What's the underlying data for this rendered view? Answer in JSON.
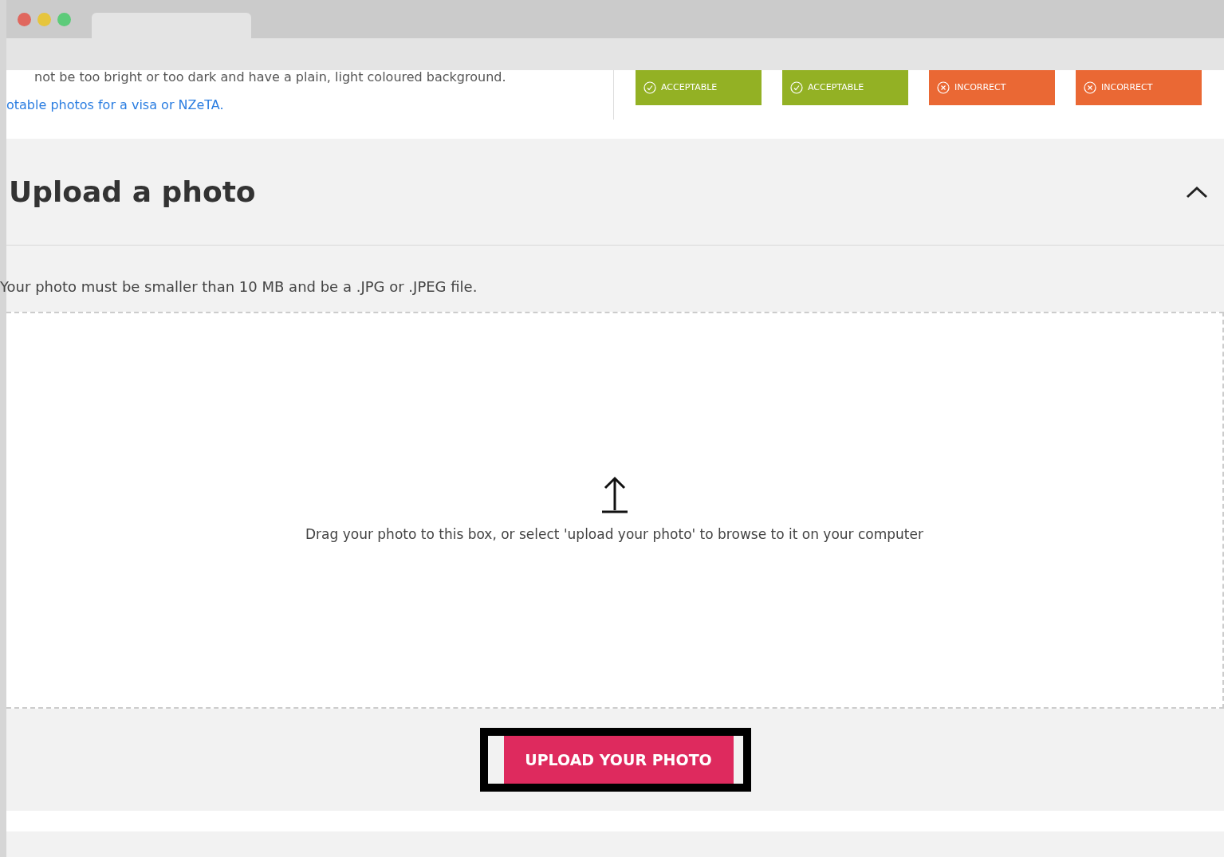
{
  "intro": {
    "text": "not be too bright or too dark and have a plain, light coloured background.",
    "link": "otable photos for a visa or NZeTA."
  },
  "examples": [
    {
      "kind": "acceptable",
      "label": "ACCEPTABLE"
    },
    {
      "kind": "acceptable",
      "label": "ACCEPTABLE"
    },
    {
      "kind": "incorrect",
      "label": "INCORRECT"
    },
    {
      "kind": "incorrect",
      "label": "INCORRECT"
    }
  ],
  "section": {
    "title": "Upload a photo",
    "expanded": true,
    "note": "Your photo must be smaller than 10 MB and be a .JPG or .JPEG file.",
    "dropzone_text": "Drag your photo to this box, or select 'upload your photo' to browse to it on your computer",
    "button": "UPLOAD YOUR PHOTO"
  }
}
